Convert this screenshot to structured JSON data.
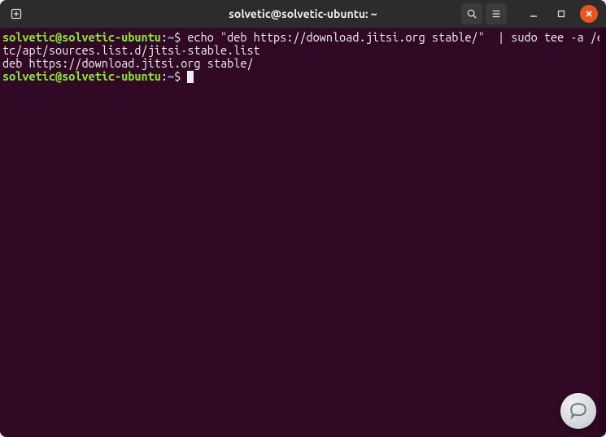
{
  "window": {
    "title": "solvetic@solvetic-ubuntu: ~"
  },
  "prompt1": {
    "user": "solvetic",
    "at": "@",
    "host": "solvetic-ubuntu",
    "colon": ":",
    "path": "~",
    "dollar": "$"
  },
  "command1": " echo \"deb https://download.jitsi.org stable/\"  | sudo tee -a /etc/apt/sources.list.d/jitsi-stable.list",
  "output1": "deb https://download.jitsi.org stable/",
  "prompt2": {
    "user": "solvetic",
    "at": "@",
    "host": "solvetic-ubuntu",
    "colon": ":",
    "path": "~",
    "dollar": "$"
  },
  "command2": " ",
  "icons": {
    "new_tab": "new-tab-icon",
    "search": "search-icon",
    "menu": "hamburger-menu-icon",
    "minimize": "minimize-icon",
    "maximize": "maximize-icon",
    "close": "close-icon",
    "chat": "chat-assist-icon"
  }
}
